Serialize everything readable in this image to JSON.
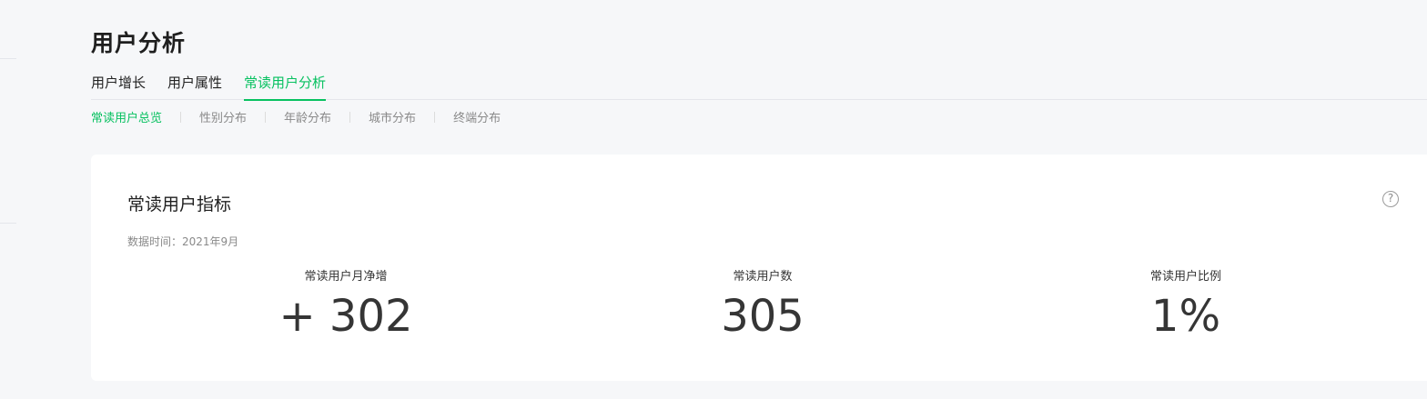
{
  "page": {
    "title": "用户分析"
  },
  "tabs": [
    {
      "label": "用户增长"
    },
    {
      "label": "用户属性"
    },
    {
      "label": "常读用户分析"
    }
  ],
  "subtabs": [
    {
      "label": "常读用户总览"
    },
    {
      "label": "性别分布"
    },
    {
      "label": "年龄分布"
    },
    {
      "label": "城市分布"
    },
    {
      "label": "终端分布"
    }
  ],
  "card": {
    "title": "常读用户指标",
    "help_glyph": "?",
    "data_time_label": "数据时间：",
    "data_time_value": "2021年9月",
    "metrics": [
      {
        "label": "常读用户月净增",
        "value": "+ 302"
      },
      {
        "label": "常读用户数",
        "value": "305"
      },
      {
        "label": "常读用户比例",
        "value": "1%"
      }
    ]
  },
  "colors": {
    "accent": "#07c160",
    "background": "#f6f7f9",
    "card": "#ffffff"
  },
  "icons": {
    "help": "question-circle-icon"
  }
}
